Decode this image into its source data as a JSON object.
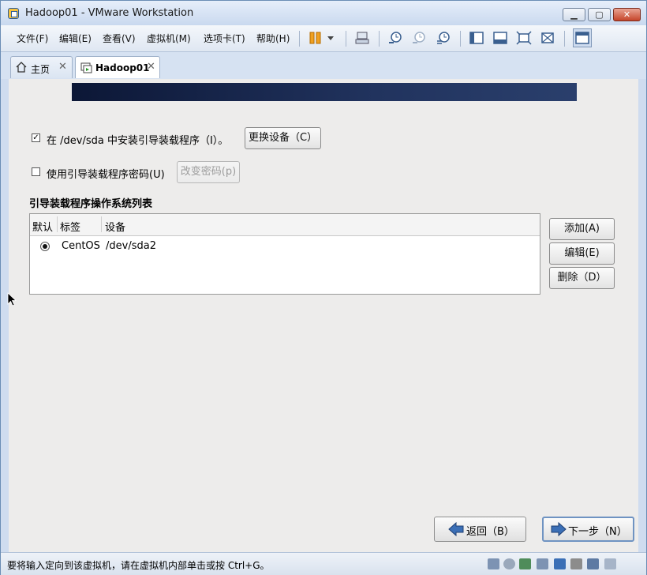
{
  "window": {
    "title": "Hadoop01 - VMware Workstation",
    "minimize_glyph": "▁",
    "maximize_glyph": "▢",
    "close_glyph": "✕"
  },
  "menubar": {
    "items": [
      "文件(F)",
      "编辑(E)",
      "查看(V)",
      "虚拟机(M)",
      "选项卡(T)",
      "帮助(H)"
    ]
  },
  "toolbar": {
    "icons": [
      "pause-icon",
      "dropdown-arrow-icon",
      "send-ctrl-alt-del-icon",
      "snapshot-take-icon",
      "snapshot-revert-icon",
      "snapshot-manager-icon",
      "show-sidebar-icon",
      "thumbnail-bar-icon",
      "fullscreen-icon",
      "unity-icon",
      "console-view-icon"
    ]
  },
  "tabs": [
    {
      "label": "主页",
      "icon": "home-icon",
      "close": "✕"
    },
    {
      "label": "Hadoop01",
      "icon": "vm-icon",
      "close": "✕"
    }
  ],
  "installer": {
    "install_bootloader": {
      "label": "在 /dev/sda 中安装引导装载程序（I）。",
      "checked": true,
      "check_glyph": "✓"
    },
    "change_device_button": "更换设备（C）",
    "use_password": {
      "label": "使用引导装载程序密码(U)",
      "checked": false
    },
    "change_password_button": "改变密码(p)",
    "os_list_title": "引导装载程序操作系统列表",
    "columns": [
      "默认",
      "标签",
      "设备"
    ],
    "rows": [
      {
        "default": true,
        "label": "CentOS",
        "device": "/dev/sda2"
      }
    ],
    "add_button": "添加(A)",
    "edit_button": "编辑(E)",
    "delete_button": "删除（D）",
    "back_button": "返回（B）",
    "next_button": "下一步（N）"
  },
  "statusbar": {
    "text": "要将输入定向到该虚拟机，请在虚拟机内部单击或按 Ctrl+G。",
    "icons": [
      "hard-disk-icon",
      "cd-drive-icon",
      "network-icon",
      "usb-icon",
      "sound-icon",
      "printer-icon",
      "display-icon",
      "message-icon"
    ]
  },
  "colors": {
    "accent": "#3b6fb6",
    "guest_background": "#edeceb",
    "banner": "#1a2a52"
  }
}
